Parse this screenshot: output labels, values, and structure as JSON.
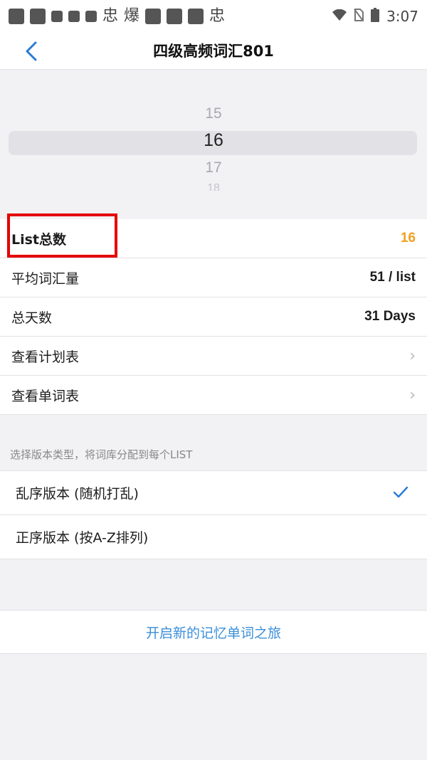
{
  "status_bar": {
    "time": "3:07",
    "left_glyphs": [
      "忠",
      "爆",
      "忠"
    ],
    "icons": [
      "wifi-icon",
      "no-sim-icon",
      "battery-icon"
    ]
  },
  "nav": {
    "title": "四级高频词汇801",
    "back_icon": "chevron-left-icon"
  },
  "picker": {
    "options": [
      "15",
      "16",
      "17",
      "18"
    ],
    "selected": "16"
  },
  "settings": {
    "list_total": {
      "label": "List总数",
      "value": "16"
    },
    "avg_words": {
      "label": "平均词汇量",
      "value": "51 / list"
    },
    "total_days": {
      "label": "总天数",
      "value": "31 Days"
    },
    "view_plan": {
      "label": "查看计划表"
    },
    "view_words": {
      "label": "查看单词表"
    }
  },
  "version_hint": "选择版本类型，将词库分配到每个LIST",
  "versions": [
    {
      "label": "乱序版本 (随机打乱)",
      "selected": true
    },
    {
      "label": "正序版本 (按A-Z排列)",
      "selected": false
    }
  ],
  "start_button": {
    "label": "开启新的记忆单词之旅"
  },
  "colors": {
    "accent_orange": "#f0a020",
    "link_blue": "#3b8fd9",
    "check_blue": "#2a7ad6",
    "highlight_red": "#e50000"
  }
}
